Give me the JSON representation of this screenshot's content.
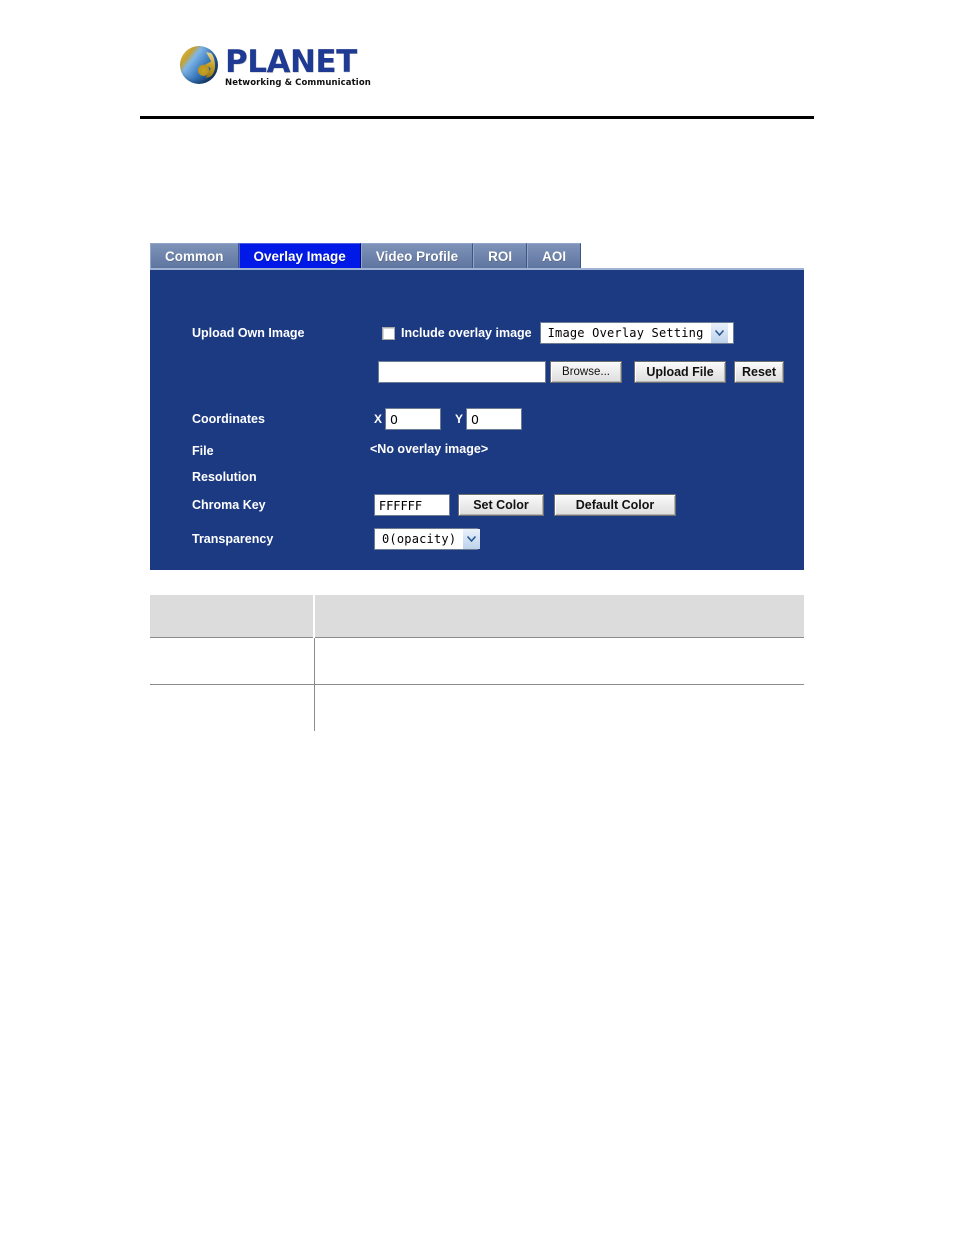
{
  "header": {
    "brand_name": "PLANET",
    "brand_tagline": "Networking & Communication",
    "logo_icon": "planet-globe-logo"
  },
  "colors": {
    "panel_background": "#1C3A82",
    "active_tab": "#0019E6",
    "inactive_tab": "#6D83AC",
    "table_header": "#DCDCDC",
    "brand_blue": "#1F3A93"
  },
  "tabs": [
    {
      "label": "Common",
      "active": false
    },
    {
      "label": "Overlay Image",
      "active": true
    },
    {
      "label": "Video Profile",
      "active": false
    },
    {
      "label": "ROI",
      "active": false
    },
    {
      "label": "AOI",
      "active": false
    }
  ],
  "form": {
    "upload_own_image": {
      "label": "Upload Own Image",
      "checkbox_label": "Include overlay image",
      "checkbox_checked": false,
      "overlay_setting_select": {
        "value": "Image Overlay Setting",
        "options": [
          "Image Overlay Setting"
        ],
        "arrow_icon": "chevron-down-icon"
      }
    },
    "file_picker": {
      "path_value": "",
      "path_placeholder": "",
      "browse_label": "Browse...",
      "upload_label": "Upload File",
      "reset_label": "Reset"
    },
    "coordinates": {
      "label": "Coordinates",
      "x_letter": "X",
      "x_value": "0",
      "y_letter": "Y",
      "y_value": "0"
    },
    "file": {
      "label": "File",
      "value": "<No overlay image>"
    },
    "resolution": {
      "label": "Resolution",
      "value": ""
    },
    "chroma_key": {
      "label": "Chroma Key",
      "value": "FFFFFF",
      "set_color_label": "Set Color",
      "default_color_label": "Default Color"
    },
    "transparency": {
      "label": "Transparency",
      "select": {
        "value": "0(opacity)",
        "options": [
          "0(opacity)"
        ],
        "arrow_icon": "chevron-down-icon"
      }
    }
  },
  "description_table": {
    "headers": [
      "",
      ""
    ],
    "rows": [
      [
        "",
        ""
      ],
      [
        "",
        ""
      ]
    ]
  }
}
